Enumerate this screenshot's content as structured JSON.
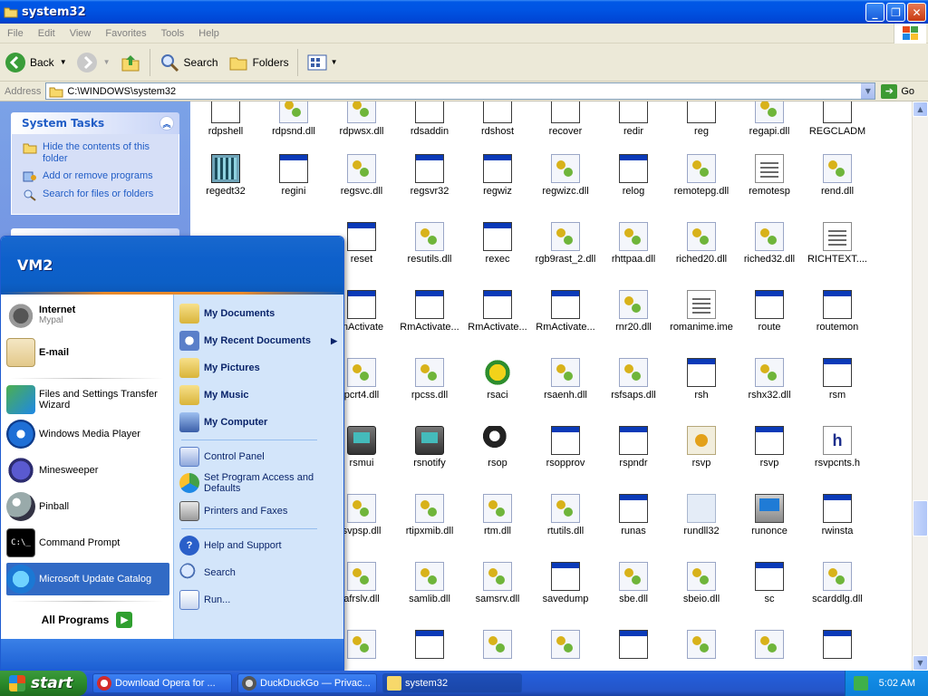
{
  "window": {
    "title": "system32",
    "menu": [
      "File",
      "Edit",
      "View",
      "Favorites",
      "Tools",
      "Help"
    ],
    "toolbar": {
      "back": "Back",
      "search": "Search",
      "folders": "Folders"
    },
    "address": {
      "label": "Address",
      "path": "C:\\WINDOWS\\system32",
      "go": "Go"
    }
  },
  "taskpane": {
    "title": "System Tasks",
    "links": [
      "Hide the contents of this folder",
      "Add or remove programs",
      "Search for files or folders"
    ]
  },
  "files": [
    [
      "rdpshell",
      "rdpsnd.dll",
      "rdpwsx.dll",
      "rdsaddin",
      "rdshost",
      "recover",
      "redir",
      "reg",
      "regapi.dll",
      "REGCLADM"
    ],
    [
      "regedt32",
      "regini",
      "regsvc.dll",
      "regsvr32",
      "regwiz",
      "regwizc.dll",
      "relog",
      "remotepg.dll",
      "remotesp",
      "rend.dll"
    ],
    [
      "",
      "",
      "reset",
      "resutils.dll",
      "rexec",
      "rgb9rast_2.dll",
      "rhttpaa.dll",
      "riched20.dll",
      "riched32.dll",
      "RICHTEXT...."
    ],
    [
      "",
      "",
      "mActivate",
      "RmActivate...",
      "RmActivate...",
      "RmActivate...",
      "rnr20.dll",
      "romanime.ime",
      "route",
      "routemon"
    ],
    [
      "",
      "",
      "pcrt4.dll",
      "rpcss.dll",
      "rsaci",
      "rsaenh.dll",
      "rsfsaps.dll",
      "rsh",
      "rshx32.dll",
      "rsm"
    ],
    [
      "",
      "",
      "rsmui",
      "rsnotify",
      "rsop",
      "rsopprov",
      "rspndr",
      "rsvp",
      "rsvp",
      "rsvpcnts.h"
    ],
    [
      "",
      "",
      "svpsp.dll",
      "rtipxmib.dll",
      "rtm.dll",
      "rtutils.dll",
      "runas",
      "rundll32",
      "runonce",
      "rwinsta"
    ],
    [
      "",
      "",
      "afrslv.dll",
      "samlib.dll",
      "samsrv.dll",
      "savedump",
      "sbe.dll",
      "sbeio.dll",
      "sc",
      "scarddlg.dll"
    ],
    [
      "",
      "",
      "",
      "",
      "",
      "",
      "",
      "",
      "",
      ""
    ]
  ],
  "startmenu": {
    "user": "VM2",
    "pinned": [
      {
        "title": "Internet",
        "subtitle": "Mypal"
      },
      {
        "title": "E-mail",
        "subtitle": ""
      }
    ],
    "recent": [
      "Files and Settings Transfer Wizard",
      "Windows Media Player",
      "Minesweeper",
      "Pinball",
      "Command Prompt",
      "Microsoft Update Catalog"
    ],
    "all_programs": "All Programs",
    "places": [
      "My Documents",
      "My Recent Documents",
      "My Pictures",
      "My Music",
      "My Computer"
    ],
    "settings": [
      "Control Panel",
      "Set Program Access and Defaults",
      "Printers and Faxes"
    ],
    "help": [
      "Help and Support",
      "Search",
      "Run..."
    ]
  },
  "taskbar": {
    "start": "start",
    "apps": [
      "Download Opera for ...",
      "DuckDuckGo — Privac...",
      "system32"
    ],
    "clock": "5:02 AM"
  }
}
